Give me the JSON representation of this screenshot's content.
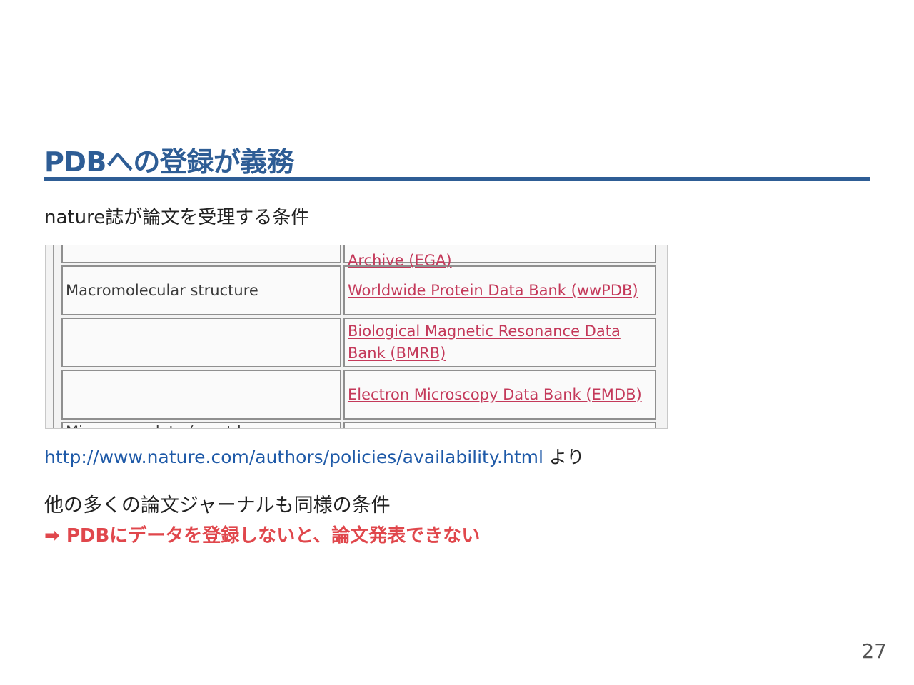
{
  "slide": {
    "title": "PDBへの登録が義務",
    "subtitle": "nature誌が論文を受理する条件",
    "source_url": "http://www.nature.com/authors/policies/availability.html",
    "source_suffix": " より",
    "note_line1": "他の多くの論文ジャーナルも同様の条件",
    "note_line2": "➡ PDBにデータを登録しないと、論文発表できない",
    "page_number": "27",
    "colors": {
      "title": "#2e5d95",
      "url": "#1f5aa8",
      "emphasis": "#e0474c",
      "table_link": "#c4395a"
    }
  },
  "embedded_table": {
    "partial_top_link": "Archive (EGA)",
    "rows": [
      {
        "category": "Macromolecular structure",
        "link": "Worldwide Protein Data Bank (wwPDB)"
      },
      {
        "category": "",
        "link": "Biological Magnetic Resonance Data Bank (BMRB)"
      },
      {
        "category": "",
        "link": "Electron Microscopy Data Bank (EMDB)"
      }
    ],
    "partial_bottom_category": "Microarray data (must be"
  }
}
